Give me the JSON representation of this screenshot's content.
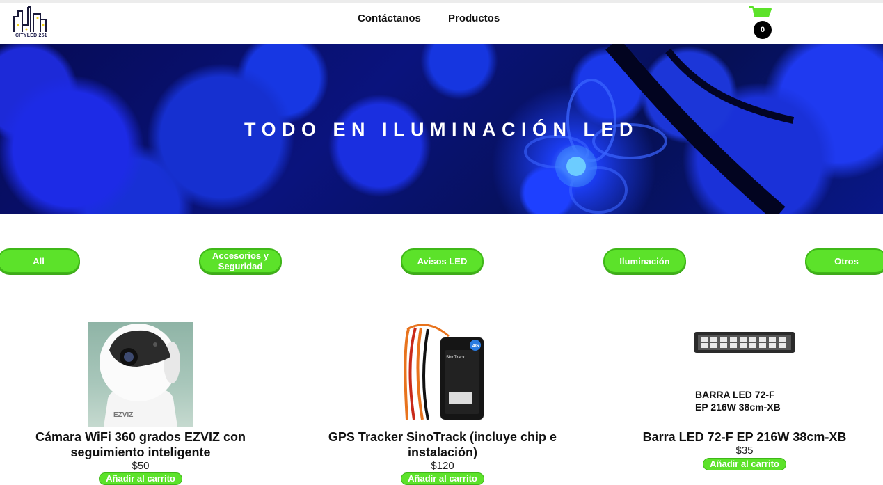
{
  "brand": {
    "logo_text": "CITYLED 251"
  },
  "nav": {
    "contact": "Contáctanos",
    "products": "Productos"
  },
  "cart": {
    "count": "0"
  },
  "hero": {
    "title": "TODO EN ILUMINACIÓN LED"
  },
  "categories": [
    "All",
    "Accesorios y Seguridad",
    "Avisos LED",
    "Iluminación",
    "Otros"
  ],
  "products": [
    {
      "name": "Cámara WiFi 360 grados EZVIZ con seguimiento inteligente",
      "price": "$50",
      "button": "Añadir al carrito",
      "image_label": "EZVIZ"
    },
    {
      "name": "GPS Tracker SinoTrack (incluye chip e instalación)",
      "price": "$120",
      "button": "Añadir al carrito",
      "image_label": "SinoTrack",
      "image_badge": "4G"
    },
    {
      "name": "Barra LED 72-F EP 216W 38cm-XB",
      "price": "$35",
      "button": "Añadir al carrito",
      "image_caption_line1": "BARRA LED 72-F",
      "image_caption_line2": "EP 216W 38cm-XB"
    }
  ],
  "colors": {
    "accent_green": "#5ce22a",
    "hero_blue": "#0a137d"
  }
}
